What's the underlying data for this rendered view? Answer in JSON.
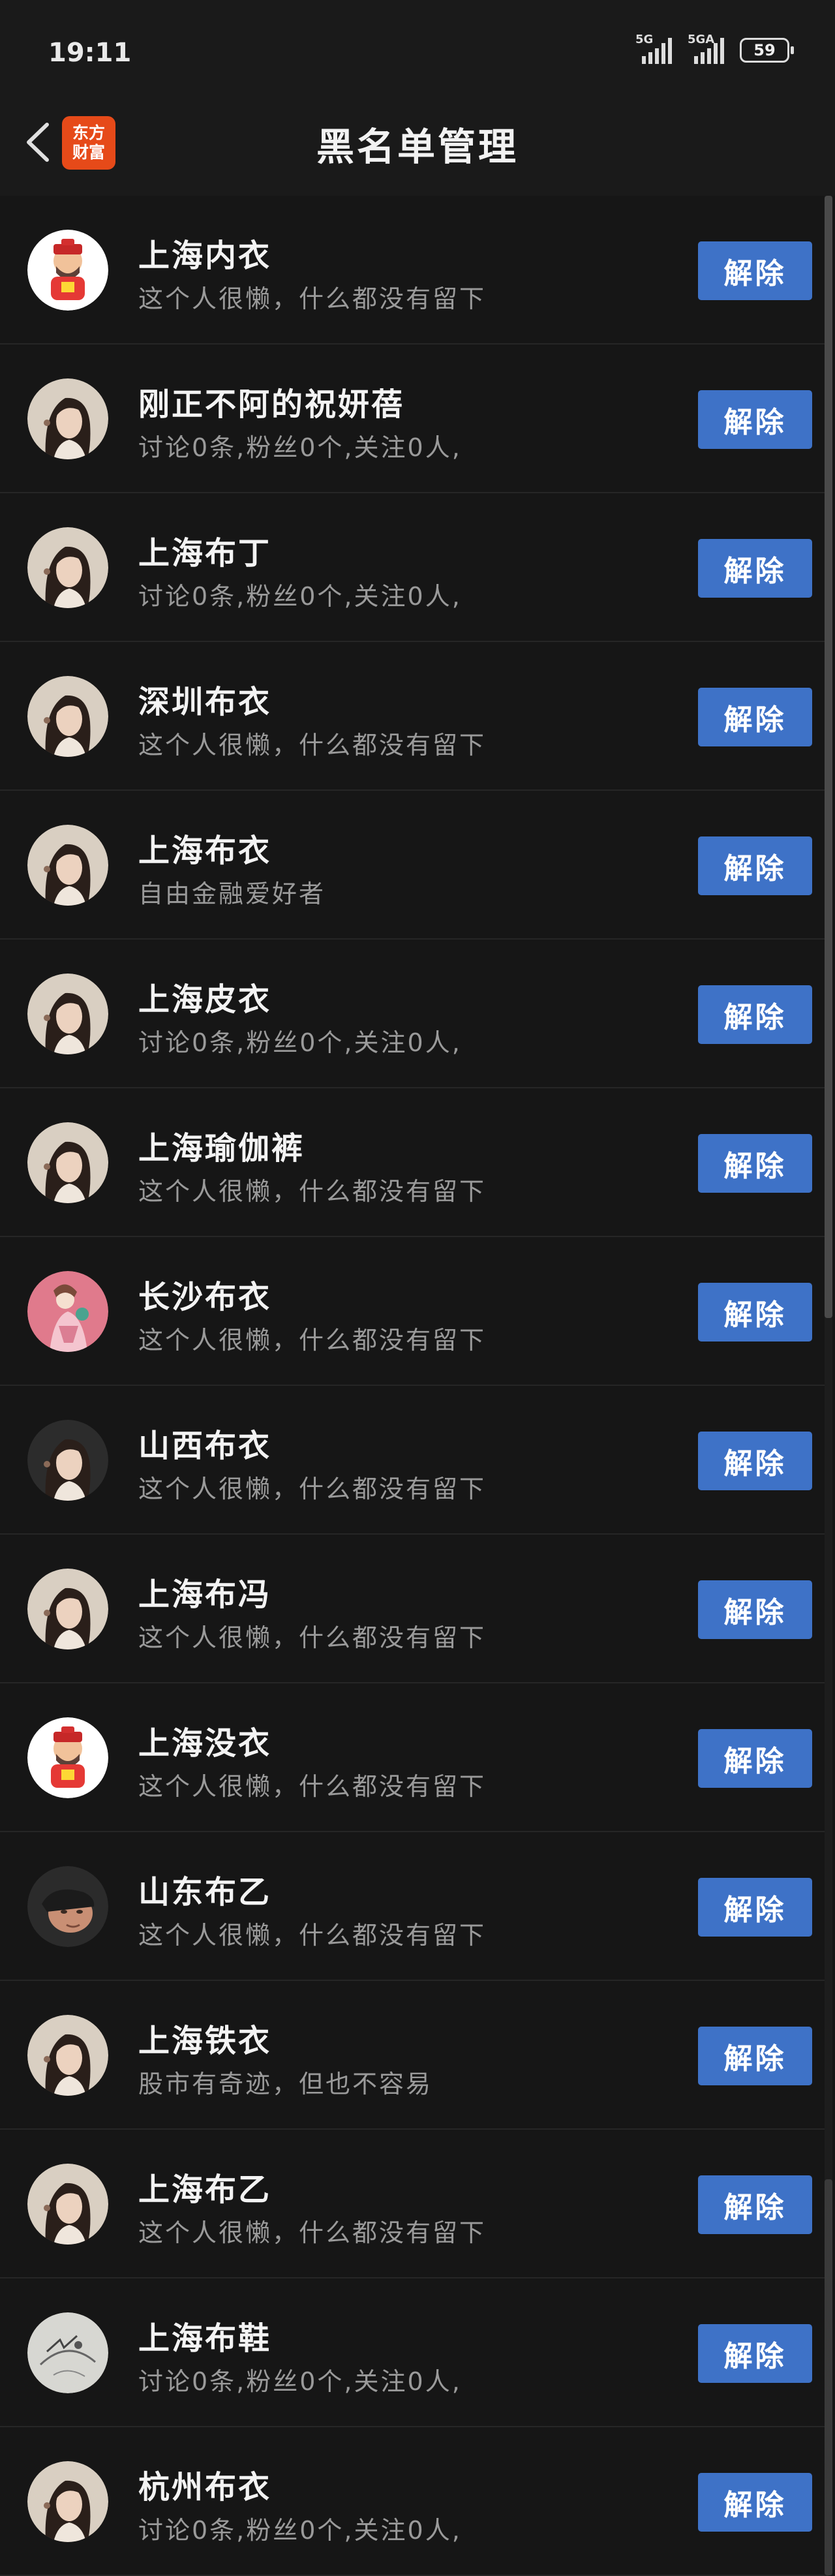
{
  "status": {
    "time": "19:11",
    "sig1": "5G",
    "sig2": "5GA",
    "battery": "59"
  },
  "header": {
    "title": "黑名单管理",
    "logo_line1": "东方",
    "logo_line2": "财富"
  },
  "unblock_label": "解除",
  "users": [
    {
      "name": "上海内衣",
      "desc": "这个人很懒，什么都没有留下",
      "avatar": "fortune"
    },
    {
      "name": "刚正不阿的祝妍蓓",
      "desc": "讨论0条,粉丝0个,关注0人,",
      "avatar": "woman"
    },
    {
      "name": "上海布丁",
      "desc": "讨论0条,粉丝0个,关注0人,",
      "avatar": "woman"
    },
    {
      "name": "深圳布衣",
      "desc": "这个人很懒，什么都没有留下",
      "avatar": "woman"
    },
    {
      "name": "上海布衣",
      "desc": "自由金融爱好者",
      "avatar": "woman"
    },
    {
      "name": "上海皮衣",
      "desc": "讨论0条,粉丝0个,关注0人,",
      "avatar": "woman"
    },
    {
      "name": "上海瑜伽裤",
      "desc": "这个人很懒，什么都没有留下",
      "avatar": "woman"
    },
    {
      "name": "长沙布衣",
      "desc": "这个人很懒，什么都没有留下",
      "avatar": "pink"
    },
    {
      "name": "山西布衣",
      "desc": "这个人很懒，什么都没有留下",
      "avatar": "woman-dark"
    },
    {
      "name": "上海布冯",
      "desc": "这个人很懒，什么都没有留下",
      "avatar": "woman"
    },
    {
      "name": "上海没衣",
      "desc": "这个人很懒，什么都没有留下",
      "avatar": "fortune"
    },
    {
      "name": "山东布乙",
      "desc": "这个人很懒，什么都没有留下",
      "avatar": "man"
    },
    {
      "name": "上海铁衣",
      "desc": "股市有奇迹，但也不容易",
      "avatar": "woman"
    },
    {
      "name": "上海布乙",
      "desc": "这个人很懒，什么都没有留下",
      "avatar": "woman"
    },
    {
      "name": "上海布鞋",
      "desc": "讨论0条,粉丝0个,关注0人,",
      "avatar": "sketch"
    },
    {
      "name": "杭州布衣",
      "desc": "讨论0条,粉丝0个,关注0人,",
      "avatar": "woman"
    }
  ]
}
